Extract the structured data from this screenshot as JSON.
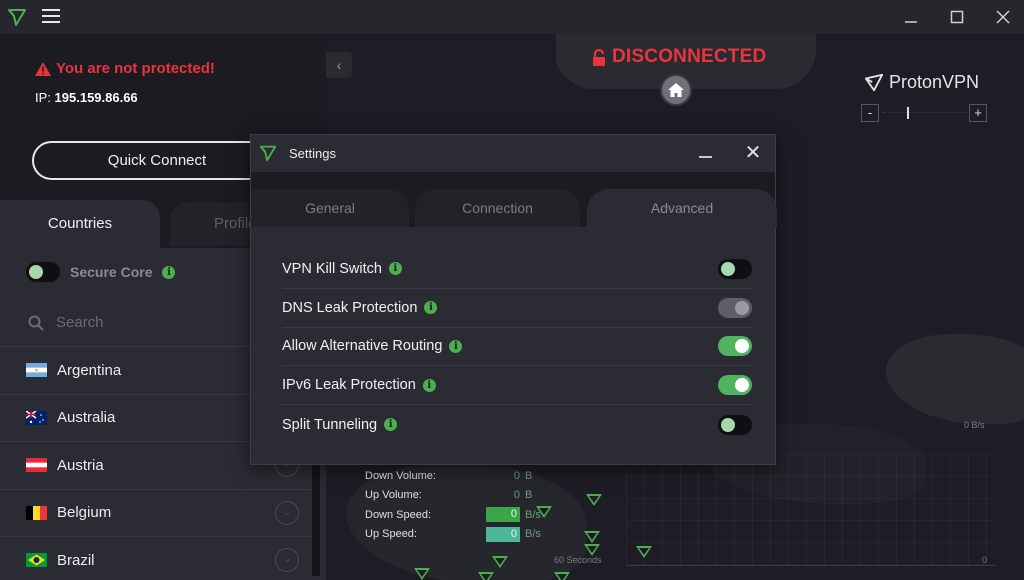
{
  "window": {
    "logo_icon": "protonvpn-logo-icon",
    "menu_icon": "hamburger-menu-icon",
    "controls": {
      "minimize": "minimize-icon",
      "maximize": "maximize-icon",
      "close": "close-icon"
    }
  },
  "status_panel": {
    "warning": "You are not protected!",
    "ip_label": "IP:",
    "ip_value": "195.159.86.66",
    "quick_connect_label": "Quick Connect"
  },
  "sidebar": {
    "tabs": [
      {
        "label": "Countries",
        "active": true
      },
      {
        "label": "Profiles",
        "active": false
      }
    ],
    "secure_core": {
      "label": "Secure Core",
      "enabled": false
    },
    "search": {
      "placeholder": "Search",
      "value": ""
    },
    "countries": [
      {
        "name": "Argentina",
        "flag": "ar"
      },
      {
        "name": "Australia",
        "flag": "au"
      },
      {
        "name": "Austria",
        "flag": "at"
      },
      {
        "name": "Belgium",
        "flag": "be"
      },
      {
        "name": "Brazil",
        "flag": "br"
      }
    ]
  },
  "map": {
    "connection_status": "DISCONNECTED",
    "brand": "ProtonVPN",
    "zoom_minus": "-",
    "zoom_plus": "+",
    "stats": {
      "down_volume": {
        "label": "Down Volume:",
        "value": "0",
        "unit": "B"
      },
      "up_volume": {
        "label": "Up Volume:",
        "value": "0",
        "unit": "B"
      },
      "down_speed": {
        "label": "Down Speed:",
        "value": "0",
        "unit": "B/s"
      },
      "up_speed": {
        "label": "Up Speed:",
        "value": "0",
        "unit": "B/s"
      }
    },
    "graph": {
      "max_label": "0 B/s",
      "min_label": "0",
      "time_label": "60 Seconds"
    }
  },
  "settings_dialog": {
    "title": "Settings",
    "tabs": [
      {
        "label": "General",
        "active": false
      },
      {
        "label": "Connection",
        "active": false
      },
      {
        "label": "Advanced",
        "active": true
      }
    ],
    "options": [
      {
        "label": "VPN Kill Switch",
        "state": "off"
      },
      {
        "label": "DNS Leak Protection",
        "state": "disabled"
      },
      {
        "label": "Allow Alternative Routing",
        "state": "on"
      },
      {
        "label": "IPv6 Leak Protection",
        "state": "on"
      },
      {
        "label": "Split Tunneling",
        "state": "off"
      }
    ],
    "info_glyph": "i"
  },
  "colors": {
    "accent_green": "#4caf50",
    "danger_red": "#e8353d",
    "background": "#1c1b22",
    "panel": "#2b2c33"
  }
}
